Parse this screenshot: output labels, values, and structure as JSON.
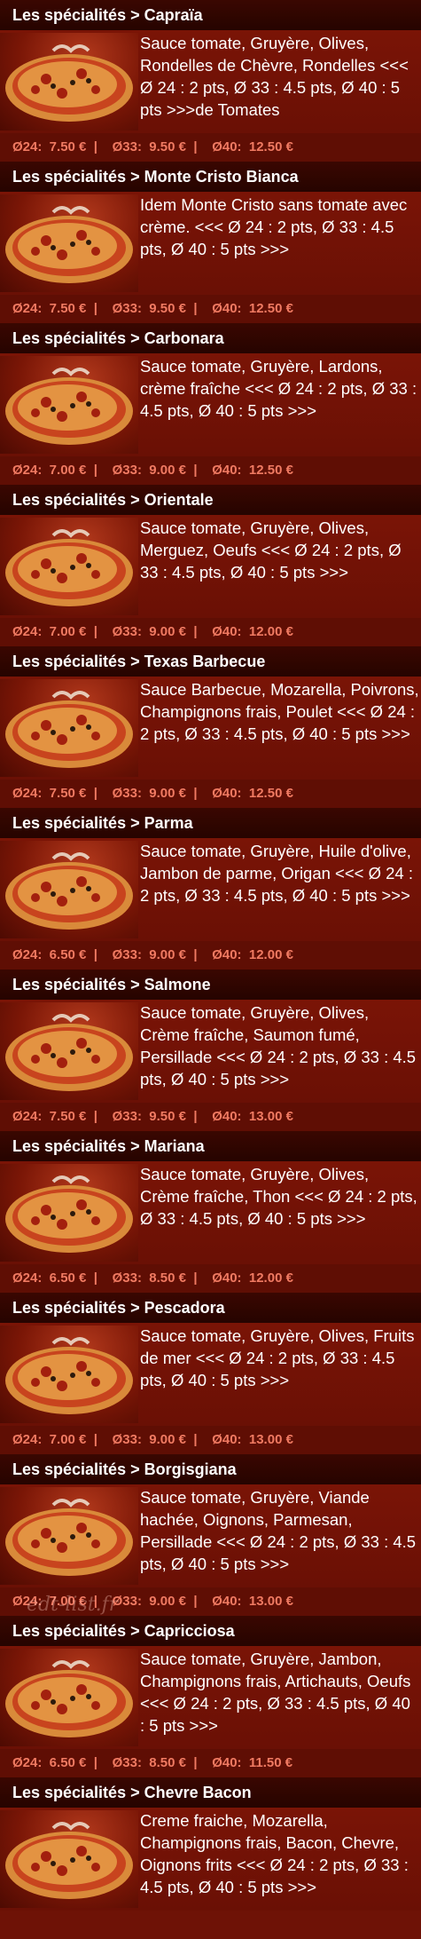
{
  "colors": {
    "header_bg": "#2d0500",
    "card_bg": "#6e1206",
    "price_text": "#f07a62",
    "text": "#ffffff"
  },
  "watermark": "edt-list.fr",
  "cards": [
    {
      "title": "Les spécialités > Capraïa",
      "description": "Sauce tomate, Gruyère, Olives, Rondelles de Chèvre, Rondelles <<< Ø 24 : 2 pts, Ø 33 : 4.5 pts, Ø 40 : 5 pts >>>de Tomates",
      "price_24": "Ø24:  7.50 €  |",
      "price_33": "Ø33:  9.50 €  |",
      "price_40": "Ø40:  12.50 €",
      "image_icon": "pizza-image"
    },
    {
      "title": "Les spécialités > Monte Cristo Bianca",
      "description": "Idem Monte Cristo sans tomate avec crème. <<< Ø 24 : 2 pts, Ø 33 : 4.5 pts, Ø 40 : 5 pts >>>",
      "price_24": "Ø24:  7.50 €  |",
      "price_33": "Ø33:  9.50 €  |",
      "price_40": "Ø40:  12.50 €",
      "image_icon": "pizza-image"
    },
    {
      "title": "Les spécialités > Carbonara",
      "description": "Sauce tomate, Gruyère, Lardons, crème fraîche <<< Ø 24 : 2 pts, Ø 33 : 4.5 pts, Ø 40 : 5 pts >>>",
      "price_24": "Ø24:  7.00 €  |",
      "price_33": "Ø33:  9.00 €  |",
      "price_40": "Ø40:  12.50 €",
      "image_icon": "pizza-image"
    },
    {
      "title": "Les spécialités > Orientale",
      "description": "Sauce tomate, Gruyère, Olives, Merguez, Oeufs <<< Ø 24 : 2 pts, Ø 33 : 4.5 pts, Ø 40 : 5 pts >>>",
      "price_24": "Ø24:  7.00 €  |",
      "price_33": "Ø33:  9.00 €  |",
      "price_40": "Ø40:  12.00 €",
      "image_icon": "pizza-image"
    },
    {
      "title": "Les spécialités > Texas Barbecue",
      "description": "Sauce Barbecue, Mozarella, Poivrons, Champignons frais, Poulet <<< Ø 24 : 2 pts, Ø 33 : 4.5 pts, Ø 40 : 5 pts >>>",
      "price_24": "Ø24:  7.50 €  |",
      "price_33": "Ø33:  9.00 €  |",
      "price_40": "Ø40:  12.50 €",
      "image_icon": "pizza-image"
    },
    {
      "title": "Les spécialités > Parma",
      "description": "Sauce tomate, Gruyère, Huile d'olive, Jambon de parme, Origan <<< Ø 24 : 2 pts, Ø 33 : 4.5 pts, Ø 40 : 5 pts >>>",
      "price_24": "Ø24:  6.50 €  |",
      "price_33": "Ø33:  9.00 €  |",
      "price_40": "Ø40:  12.00 €",
      "image_icon": "pizza-image"
    },
    {
      "title": "Les spécialités > Salmone",
      "description": "Sauce tomate, Gruyère, Olives, Crème fraîche, Saumon fumé, Persillade <<< Ø 24 : 2 pts, Ø 33 : 4.5 pts, Ø 40 : 5 pts >>>",
      "price_24": "Ø24:  7.50 €  |",
      "price_33": "Ø33:  9.50 €  |",
      "price_40": "Ø40:  13.00 €",
      "image_icon": "pizza-image"
    },
    {
      "title": "Les spécialités > Mariana",
      "description": "Sauce tomate, Gruyère, Olives, Crème fraîche, Thon <<< Ø 24 : 2 pts, Ø 33 : 4.5 pts, Ø 40 : 5 pts >>>",
      "price_24": "Ø24:  6.50 €  |",
      "price_33": "Ø33:  8.50 €  |",
      "price_40": "Ø40:  12.00 €",
      "image_icon": "pizza-image"
    },
    {
      "title": "Les spécialités > Pescadora",
      "description": "Sauce tomate, Gruyère, Olives, Fruits de mer <<< Ø 24 : 2 pts, Ø 33 : 4.5 pts, Ø 40 : 5 pts >>>",
      "price_24": "Ø24:  7.00 €  |",
      "price_33": "Ø33:  9.00 €  |",
      "price_40": "Ø40:  13.00 €",
      "image_icon": "pizza-image"
    },
    {
      "title": "Les spécialités > Borgisgiana",
      "description": "Sauce tomate, Gruyère, Viande hachée, Oignons, Parmesan, Persillade <<< Ø 24 : 2 pts, Ø 33 : 4.5 pts, Ø 40 : 5 pts >>>",
      "price_24": "Ø24:  7.00 €  |",
      "price_33": "Ø33:  9.00 €  |",
      "price_40": "Ø40:  13.00 €",
      "image_icon": "pizza-image"
    },
    {
      "title": "Les spécialités > Capricciosa",
      "description": "Sauce tomate, Gruyère, Jambon, Champignons frais, Artichauts, Oeufs <<< Ø 24 : 2 pts, Ø 33 : 4.5 pts, Ø 40 : 5 pts >>>",
      "price_24": "Ø24:  6.50 €  |",
      "price_33": "Ø33:  8.50 €  |",
      "price_40": "Ø40:  11.50 €",
      "image_icon": "pizza-image"
    },
    {
      "title": "Les spécialités > Chevre Bacon",
      "description": "Creme fraiche, Mozarella, Champignons frais, Bacon, Chevre, Oignons frits <<< Ø 24 : 2 pts, Ø 33 : 4.5 pts, Ø 40 : 5 pts >>>",
      "price_24": "",
      "price_33": "",
      "price_40": "",
      "image_icon": "pizza-image"
    }
  ]
}
